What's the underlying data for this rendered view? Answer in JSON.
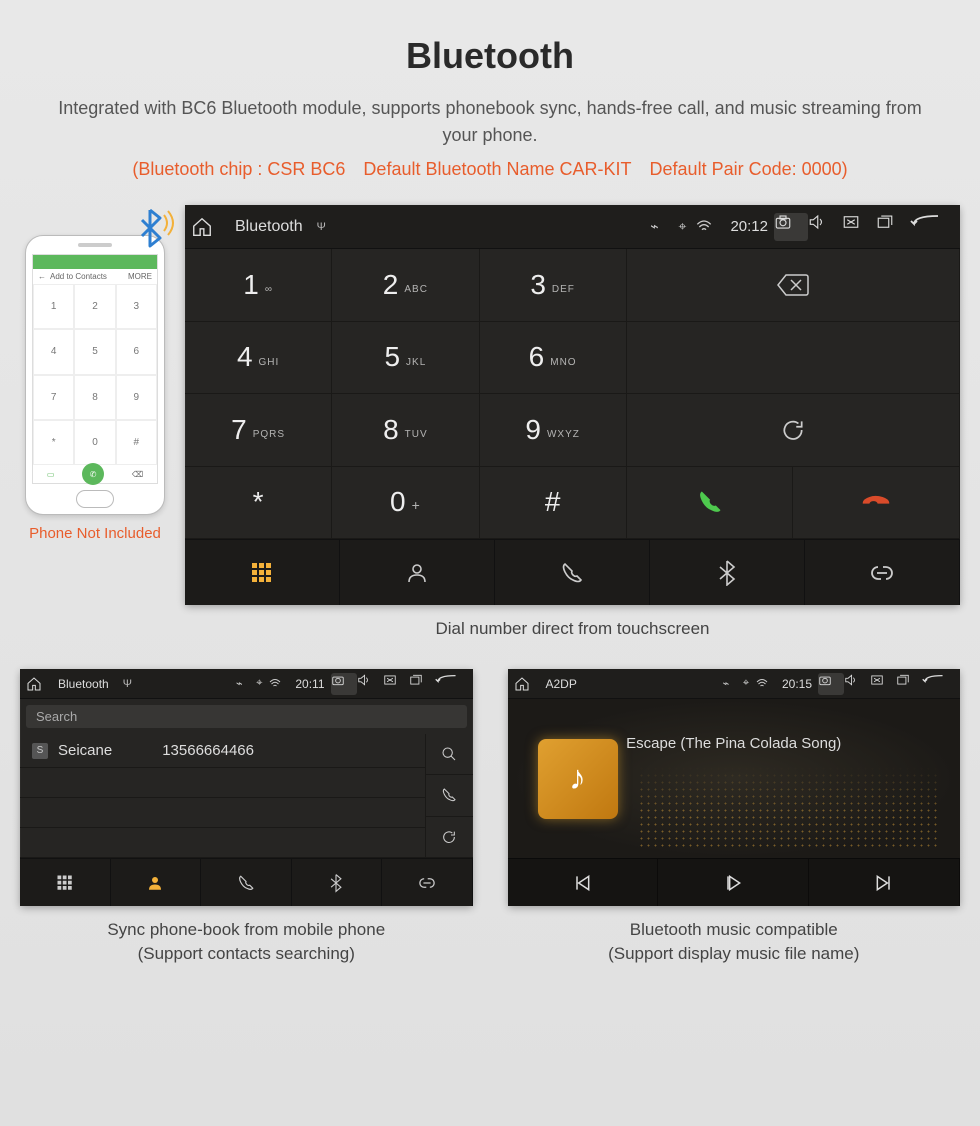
{
  "title": "Bluetooth",
  "subtitle": "Integrated with BC6 Bluetooth module, supports phonebook sync, hands-free call, and music streaming from your phone.",
  "spec_line": "(Bluetooth chip : CSR BC6 Default Bluetooth Name CAR-KIT Default Pair Code: 0000)",
  "phone": {
    "add_contacts": "Add to Contacts",
    "more": "MORE",
    "keys": [
      "1",
      "2",
      "3",
      "4",
      "5",
      "6",
      "7",
      "8",
      "9",
      "*",
      "0",
      "#"
    ],
    "note": "Phone Not Included"
  },
  "dialer": {
    "status": {
      "title": "Bluetooth",
      "time": "20:12"
    },
    "keys": [
      {
        "n": "1",
        "l": "∞"
      },
      {
        "n": "2",
        "l": "ABC"
      },
      {
        "n": "3",
        "l": "DEF"
      },
      {
        "n": "4",
        "l": "GHI"
      },
      {
        "n": "5",
        "l": "JKL"
      },
      {
        "n": "6",
        "l": "MNO"
      },
      {
        "n": "7",
        "l": "PQRS"
      },
      {
        "n": "8",
        "l": "TUV"
      },
      {
        "n": "9",
        "l": "WXYZ"
      },
      {
        "n": "*",
        "l": ""
      },
      {
        "n": "0",
        "l": "+"
      },
      {
        "n": "#",
        "l": ""
      }
    ],
    "caption": "Dial number direct from touchscreen"
  },
  "phonebook": {
    "status": {
      "title": "Bluetooth",
      "time": "20:11"
    },
    "search_placeholder": "Search",
    "rows": [
      {
        "tag": "S",
        "name": "Seicane",
        "number": "13566664466"
      }
    ],
    "caption_l1": "Sync phone-book from mobile phone",
    "caption_l2": "(Support contacts searching)"
  },
  "music": {
    "status": {
      "title": "A2DP",
      "time": "20:15"
    },
    "song": "Escape (The Pina Colada Song)",
    "caption_l1": "Bluetooth music compatible",
    "caption_l2": "(Support display music file name)"
  }
}
